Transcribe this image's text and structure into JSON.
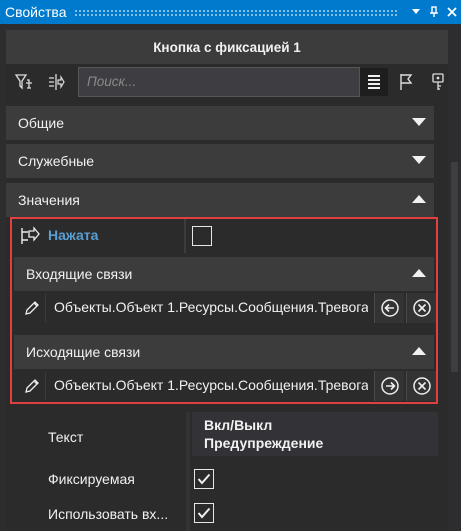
{
  "window": {
    "title": "Свойства"
  },
  "header": {
    "title": "Кнопка с фиксацией 1"
  },
  "toolbar": {
    "search_placeholder": "Поиск...",
    "left_icons": [
      "filter-icon",
      "tree-pin-icon"
    ],
    "right_icons": [
      "list-view-icon",
      "flag-icon",
      "key-icon"
    ]
  },
  "sections": {
    "general": "Общие",
    "service": "Служебные",
    "values": "Значения"
  },
  "pressed": {
    "label": "Нажата",
    "checked": false
  },
  "incoming": {
    "title": "Входящие связи",
    "path": "Объекты.Объект 1.Ресурсы.Сообщения.Тревога"
  },
  "outgoing": {
    "title": "Исходящие связи",
    "path": "Объекты.Объект 1.Ресурсы.Сообщения.Тревога"
  },
  "props": {
    "text_label": "Текст",
    "text_line1": "Вкл/Выкл",
    "text_line2": "Предупреждение",
    "fixable_label": "Фиксируемая",
    "fixable_checked": true,
    "use_label": "Использовать вх...",
    "use_checked": true
  },
  "colors": {
    "accent": "#007acc",
    "highlight_border": "#e04040",
    "label_blue": "#5a9fd4"
  }
}
